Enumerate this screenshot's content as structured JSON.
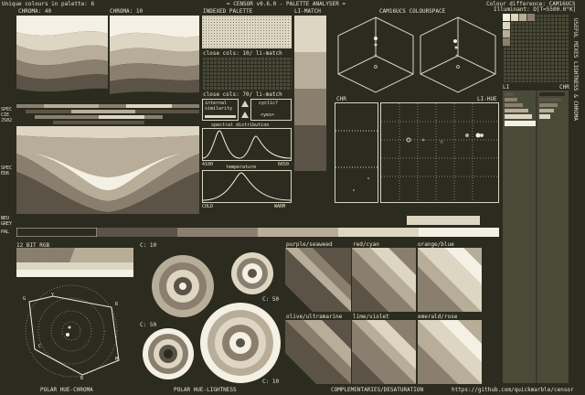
{
  "header": {
    "unique_colours": "Unique colours in palette: 6",
    "title": "= CENSOR v0.6.0 - PALETTE ANALYSER =",
    "colour_difference": "Colour difference: CAM16UCS",
    "illuminant": "Illuminant: D[T=5500.0°K]"
  },
  "sections": {
    "chroma_40": "CHROMA: 40",
    "chroma_10": "CHROMA: 10",
    "indexed_palette": "INDEXED PALETTE",
    "li_match": "LI-MATCH",
    "cam16ucs_colourspace": "CAM16UCS COLOURSPACE",
    "close_cols_1": "close cols: 10/ li-match",
    "close_cols_2": "close cols: 70/ li-match",
    "internal_similarity": "internal\nsimilarity",
    "cyclic_label": "cyclic?",
    "cyclic_value": "<yes>",
    "spectral_distribution": "spectral distribution",
    "spectral_min": "4100",
    "spectral_max": "6650",
    "temperature": "temperature",
    "temp_cold": "COLD",
    "temp_warm": "WARM",
    "chr": "CHR",
    "li_hue": "LI-HUE",
    "li": "LI",
    "chr2": "CHR",
    "bit_rgb": "12 BIT RGB",
    "c10a": "C: 10",
    "c50a": "C: 50",
    "c50b": "C: 50",
    "c10b": "C: 10",
    "purple_seaweed": "purple/seaweed",
    "red_cyan": "red/cyan",
    "orange_blue": "orange/blue",
    "olive_ultramarine": "olive/ultramarine",
    "lime_violet": "lime/violet",
    "emerald_rose": "emerald/rose",
    "polar_hue_chroma": "POLAR HUE-CHROMA",
    "polar_hue_lightness": "POLAR HUE-LIGHTNESS",
    "complementaries": "COMPLEMENTARIES/DESATURATION",
    "github": "https://github.com/quickmarble/censor"
  },
  "side_labels": {
    "spec_cie": "SPEC",
    "cie": "CIE",
    "j502": "JS02",
    "spec2": "SPEC",
    "ed6": "ED6",
    "neu": "NEU",
    "grey": "GREY",
    "pal": "PAL",
    "vertical_right": "USEFUL MIXES  LIGHTNESS & CHROMA"
  },
  "polar_labels": {
    "g": "G",
    "y": "Y",
    "r": "R",
    "c": "C",
    "b": "B",
    "m": "M"
  },
  "palette": [
    "#2b2b1f",
    "#5a5346",
    "#8a7f6e",
    "#b8ad98",
    "#ddd6c2",
    "#f4f0e4"
  ]
}
